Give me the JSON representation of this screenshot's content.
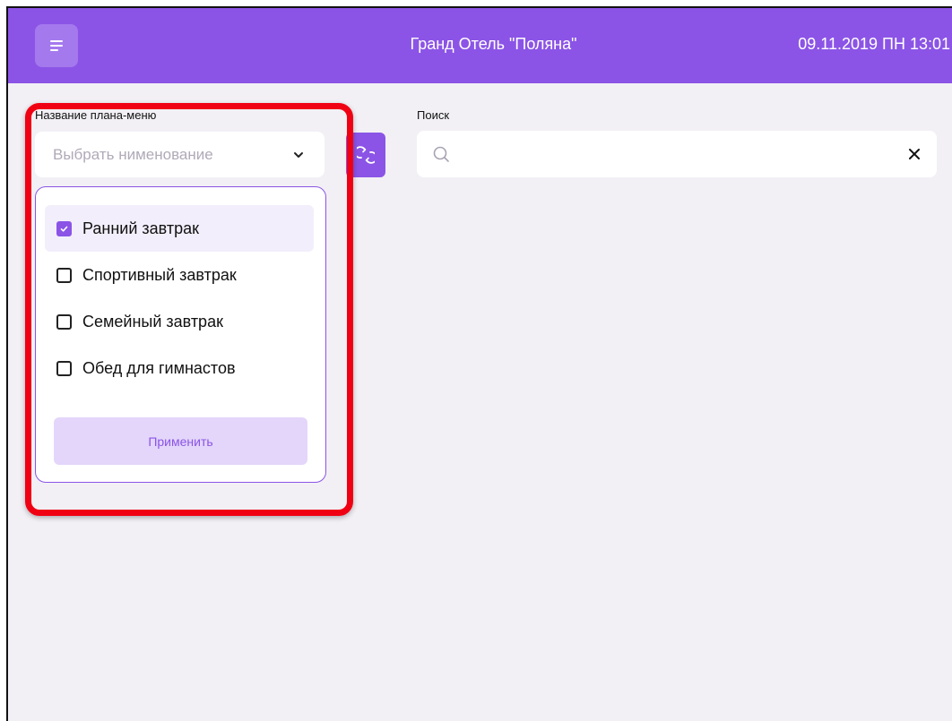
{
  "header": {
    "hotel_title": "Гранд Отель \"Поляна\"",
    "datetime": "09.11.2019 ПН 13:01",
    "menu_icon": "hamburger-icon"
  },
  "filter": {
    "label": "Название плана-меню",
    "select_placeholder": "Выбрать нименование",
    "chevron_icon": "chevron-down-icon",
    "refresh_icon": "refresh-icon",
    "options": [
      {
        "label": "Ранний завтрак",
        "checked": true
      },
      {
        "label": "Спортивный завтрак",
        "checked": false
      },
      {
        "label": "Семейный завтрак",
        "checked": false
      },
      {
        "label": "Обед для гимнастов",
        "checked": false
      }
    ],
    "apply_label": "Применить"
  },
  "search": {
    "label": "Поиск",
    "value": "",
    "search_icon": "search-icon",
    "clear_icon": "close-icon"
  },
  "colors": {
    "accent": "#8b54e6",
    "highlight": "#f00013",
    "background": "#f2f0f5"
  }
}
